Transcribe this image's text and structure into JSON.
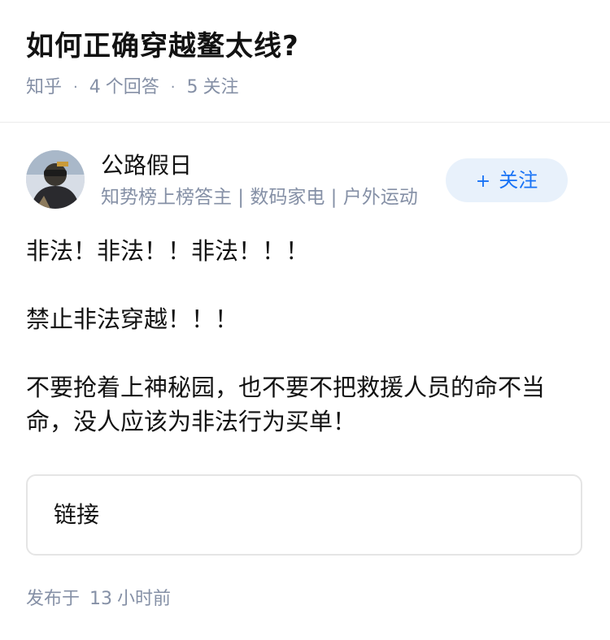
{
  "question": {
    "title": "如何正确穿越鳌太线?",
    "source": "知乎",
    "answers_count": "4",
    "answers_label": "个回答",
    "followers_count": "5",
    "followers_label": "关注"
  },
  "author": {
    "name": "公路假日",
    "badge": "知势榜上榜答主 | 数码家电 | 户外运动",
    "follow_label": "关注",
    "follow_icon": "plus-icon"
  },
  "answer": {
    "paragraphs": [
      "非法！非法！！非法！！！",
      "禁止非法穿越！！！",
      "不要抢着上神秘园，也不要不把救援人员的命不当命，没人应该为非法行为买单！"
    ]
  },
  "link_card": {
    "label": "链接"
  },
  "publish": {
    "prefix": "发布于",
    "num": "13",
    "unit": "小时前"
  },
  "colors": {
    "accent": "#1772f6",
    "follow_bg": "#e8f1fb",
    "meta": "#8590a6",
    "text": "#121212"
  }
}
